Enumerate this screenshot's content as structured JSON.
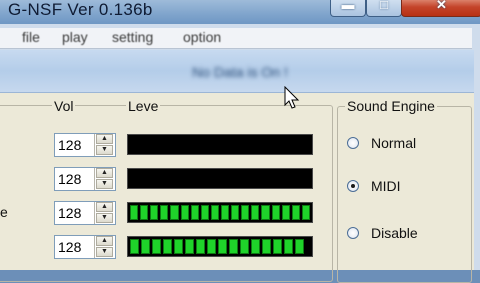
{
  "window": {
    "title": "G-NSF Ver 0.136b",
    "minimize_glyph": "▬",
    "maximize_glyph": "□",
    "close_glyph": "✕"
  },
  "menu": {
    "items": [
      "file",
      "play",
      "setting",
      "option"
    ]
  },
  "status": {
    "text": "No Data is On !"
  },
  "levels": {
    "vol_header": "Vol",
    "level_header": "Leve",
    "rows": [
      {
        "vol": "128",
        "level": 0
      },
      {
        "vol": "128",
        "level": 0
      },
      {
        "vol": "128",
        "level": 1.0
      },
      {
        "vol": "128",
        "level": 0.88
      }
    ],
    "segments_total": 18,
    "edge_char": "e"
  },
  "engine": {
    "label": "Sound Engine",
    "options": [
      {
        "label": "Normal",
        "selected": false
      },
      {
        "label": "MIDI",
        "selected": true
      },
      {
        "label": "Disable",
        "selected": false
      }
    ]
  },
  "colors": {
    "meter_on": "#1fd32a",
    "meter_bg": "#000000"
  }
}
